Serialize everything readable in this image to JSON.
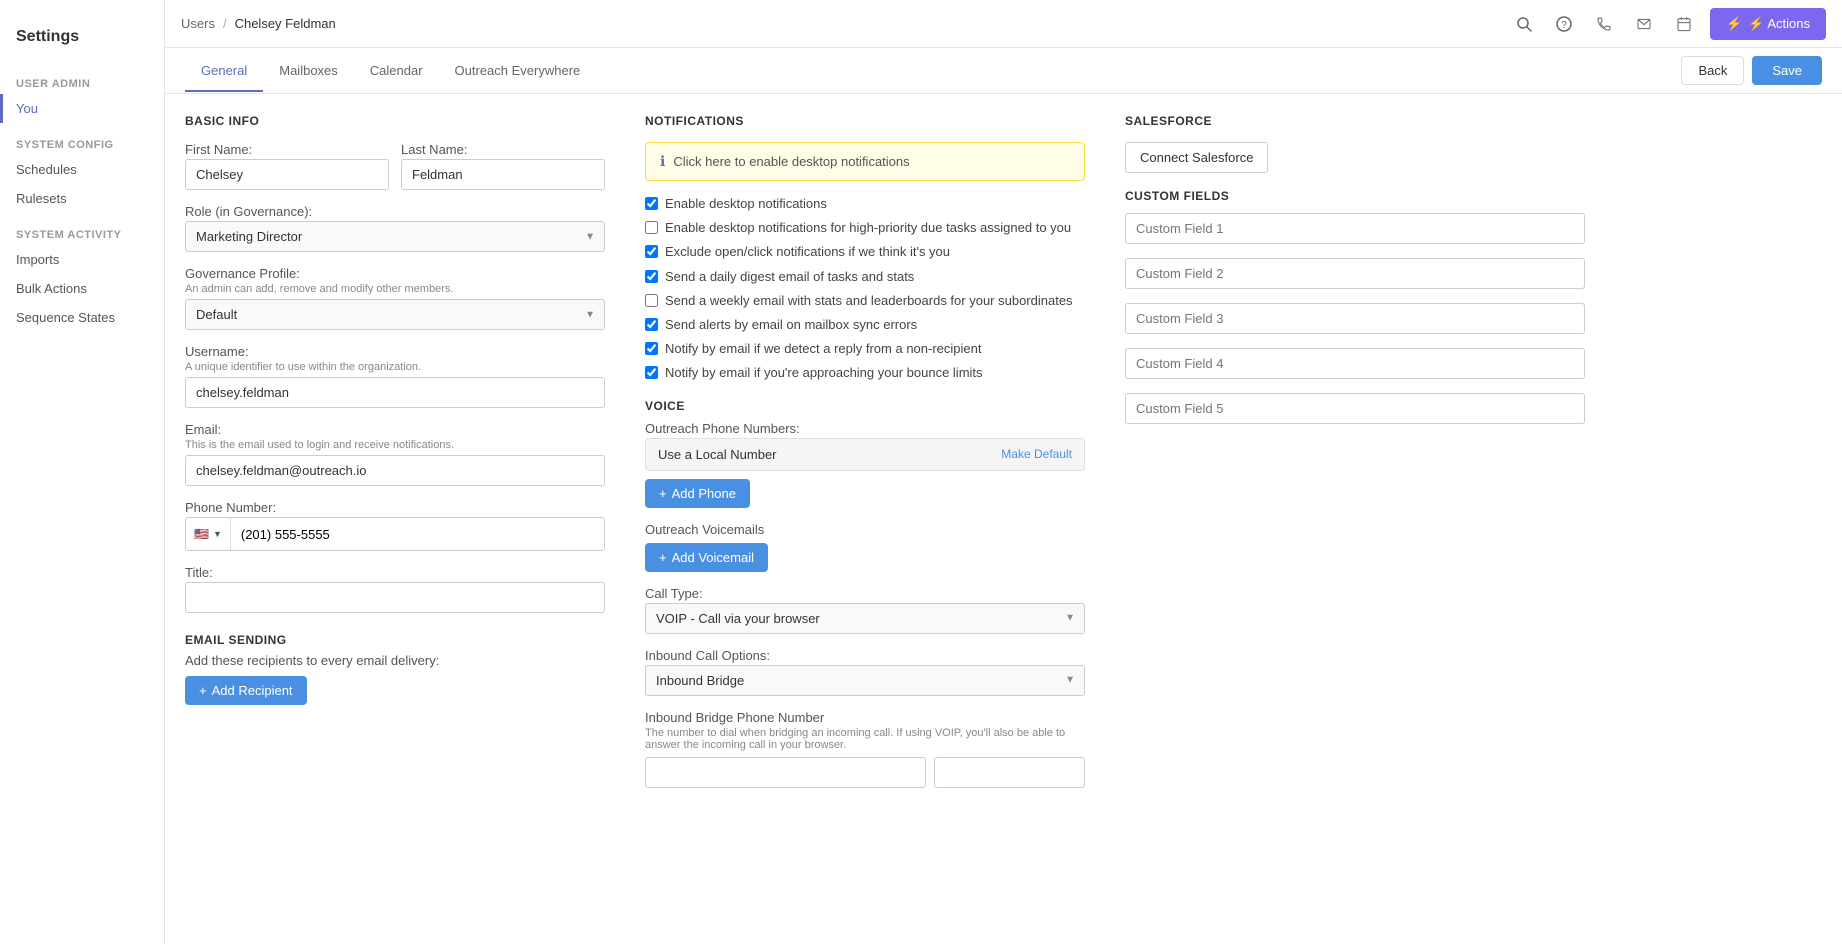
{
  "app": {
    "title": "Settings"
  },
  "topbar": {
    "breadcrumb_parent": "Users",
    "breadcrumb_separator": "/",
    "breadcrumb_current": "Chelsey Feldman",
    "actions_label": "⚡ Actions"
  },
  "sidebar": {
    "sections": [
      {
        "title": "User Admin",
        "items": [
          {
            "label": "You",
            "active": true
          }
        ]
      },
      {
        "title": "System Config",
        "items": [
          {
            "label": "Schedules",
            "active": false
          },
          {
            "label": "Rulesets",
            "active": false
          }
        ]
      },
      {
        "title": "System Activity",
        "items": [
          {
            "label": "Imports",
            "active": false
          },
          {
            "label": "Bulk Actions",
            "active": false
          },
          {
            "label": "Sequence States",
            "active": false
          }
        ]
      }
    ]
  },
  "tabs": {
    "items": [
      {
        "label": "General",
        "active": true
      },
      {
        "label": "Mailboxes",
        "active": false
      },
      {
        "label": "Calendar",
        "active": false
      },
      {
        "label": "Outreach Everywhere",
        "active": false
      }
    ],
    "back_label": "Back",
    "save_label": "Save"
  },
  "basic_info": {
    "section_title": "Basic Info",
    "first_name_label": "First Name:",
    "first_name_value": "Chelsey",
    "last_name_label": "Last Name:",
    "last_name_value": "Feldman",
    "role_label": "Role (in Governance):",
    "role_value": "Marketing Director",
    "governance_label": "Governance Profile:",
    "governance_sub": "An admin can add, remove and modify other members.",
    "governance_value": "Default",
    "username_label": "Username:",
    "username_sub": "A unique identifier to use within the organization.",
    "username_value": "chelsey.feldman",
    "email_label": "Email:",
    "email_sub": "This is the email used to login and receive notifications.",
    "email_value": "chelsey.feldman@outreach.io",
    "phone_label": "Phone Number:",
    "phone_flag": "🇺🇸",
    "phone_prefix": "+1",
    "phone_value": "(201) 555-5555",
    "title_label": "Title:",
    "title_value": "",
    "email_sending_title": "Email Sending",
    "email_sending_sub": "Add these recipients to every email delivery:",
    "add_recipient_label": "+ Add Recipient"
  },
  "notifications": {
    "section_title": "Notifications",
    "banner_text": "Click here to enable desktop notifications",
    "checkboxes": [
      {
        "label": "Enable desktop notifications",
        "checked": true
      },
      {
        "label": "Enable desktop notifications for high-priority due tasks assigned to you",
        "checked": false
      },
      {
        "label": "Exclude open/click notifications if we think it's you",
        "checked": true
      },
      {
        "label": "Send a daily digest email of tasks and stats",
        "checked": true
      },
      {
        "label": "Send a weekly email with stats and leaderboards for your subordinates",
        "checked": false
      },
      {
        "label": "Send alerts by email on mailbox sync errors",
        "checked": true
      },
      {
        "label": "Notify by email if we detect a reply from a non-recipient",
        "checked": true
      },
      {
        "label": "Notify by email if you're approaching your bounce limits",
        "checked": true
      }
    ],
    "voice_title": "Voice",
    "outreach_phone_label": "Outreach Phone Numbers:",
    "phone_row_text": "Use a Local Number",
    "phone_row_action": "Make Default",
    "add_phone_label": "+ Add Phone",
    "outreach_voicemails_label": "Outreach Voicemails",
    "add_voicemail_label": "+ Add Voicemail",
    "call_type_label": "Call Type:",
    "call_type_value": "VOIP - Call via your browser",
    "inbound_call_label": "Inbound Call Options:",
    "inbound_call_value": "Inbound Bridge",
    "inbound_bridge_label": "Inbound Bridge Phone Number",
    "inbound_bridge_sub": "The number to dial when bridging an incoming call. If using VOIP, you'll also be able to answer the incoming call in your browser."
  },
  "salesforce": {
    "section_title": "Salesforce",
    "connect_label": "Connect Salesforce",
    "custom_fields_title": "Custom Fields",
    "fields": [
      {
        "placeholder": "Custom Field 1"
      },
      {
        "placeholder": "Custom Field 2"
      },
      {
        "placeholder": "Custom Field 3"
      },
      {
        "placeholder": "Custom Field 4"
      },
      {
        "placeholder": "Custom Field 5"
      }
    ]
  }
}
